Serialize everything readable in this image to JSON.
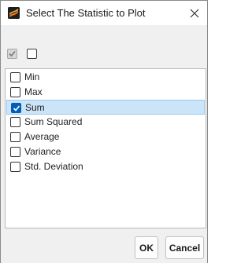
{
  "window": {
    "title": "Select The Statistic to Plot",
    "app_icon": "flame-logo-icon",
    "close_icon": "close-icon"
  },
  "bulk_selection": {
    "select_all_state": "indeterminate",
    "select_none_state": "unchecked"
  },
  "statistics": [
    {
      "label": "Min",
      "checked": false
    },
    {
      "label": "Max",
      "checked": false
    },
    {
      "label": "Sum",
      "checked": true
    },
    {
      "label": "Sum Squared",
      "checked": false
    },
    {
      "label": "Average",
      "checked": false
    },
    {
      "label": "Variance",
      "checked": false
    },
    {
      "label": "Std. Deviation",
      "checked": false
    }
  ],
  "footer": {
    "ok_label": "OK",
    "cancel_label": "Cancel"
  },
  "colors": {
    "selection_bg": "#cce4f7",
    "checkbox_accent": "#005fb8"
  }
}
